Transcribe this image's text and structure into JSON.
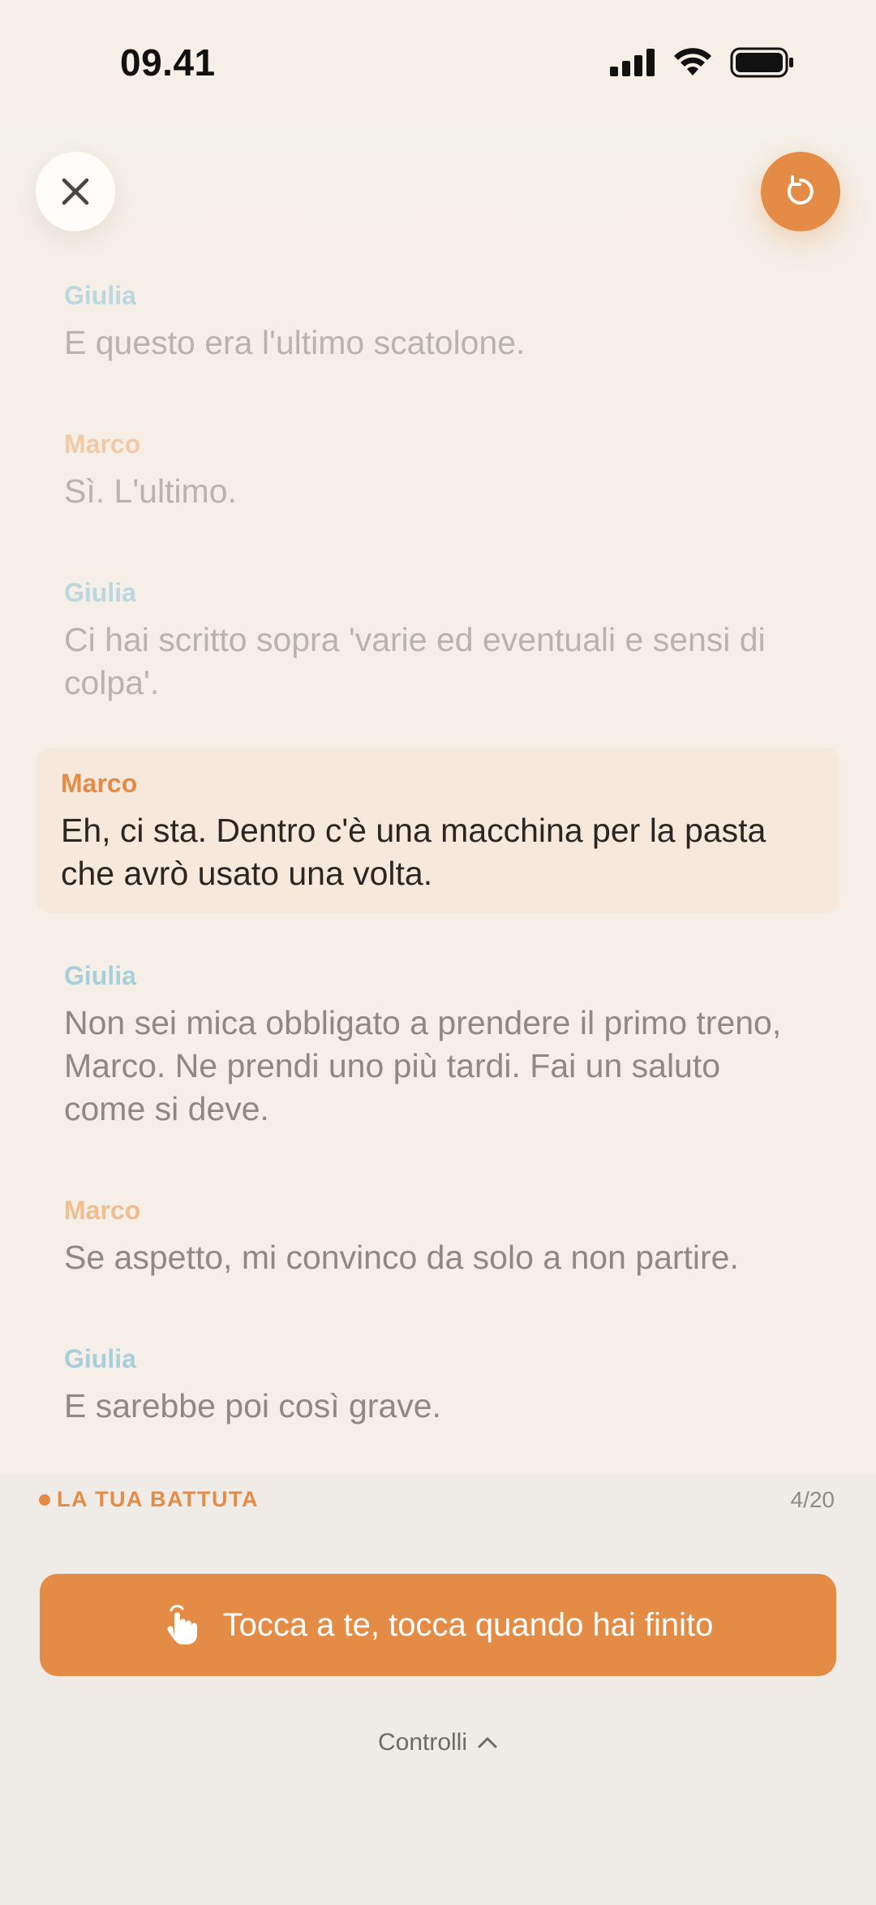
{
  "status_bar": {
    "time": "09.41",
    "icons": [
      "cellular-signal-icon",
      "wifi-icon",
      "battery-icon"
    ]
  },
  "toolbar": {
    "close_icon": "close-icon",
    "restart_icon": "restart-icon"
  },
  "colors": {
    "accent": "#e48c45",
    "giulia": "#a9cfdb",
    "current_bg": "#f6e9db",
    "background": "#f5efe8"
  },
  "script": {
    "lines": [
      {
        "speaker": "Giulia",
        "text": "E questo era l'ultimo scatolone."
      },
      {
        "speaker": "Marco",
        "text": "Sì. L'ultimo."
      },
      {
        "speaker": "Giulia",
        "text": "Ci hai scritto sopra 'varie ed eventuali e sensi di colpa'."
      },
      {
        "speaker": "Marco",
        "text": "Eh, ci sta. Dentro c'è una macchina per la pasta che avrò usato una volta."
      },
      {
        "speaker": "Giulia",
        "text": "Non sei mica obbligato a prendere il primo treno, Marco. Ne prendi uno più tardi. Fai un saluto come si deve."
      },
      {
        "speaker": "Marco",
        "text": "Se aspetto, mi convinco da solo a non partire."
      },
      {
        "speaker": "Giulia",
        "text": "E sarebbe poi così grave."
      }
    ]
  },
  "footer": {
    "your_line_label": "LA TUA BATTUTA",
    "progress": "4/20",
    "done_button": "Tocca a te, tocca quando hai finito",
    "done_icon": "tap-hand-icon",
    "controls_label": "Controlli",
    "controls_icon": "chevron-up-icon"
  }
}
